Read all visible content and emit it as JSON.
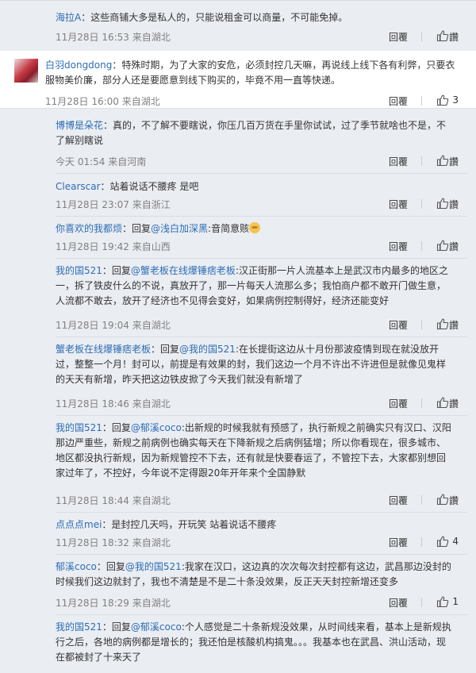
{
  "comments": [
    {
      "user": "海拉A",
      "body": "：这些商铺大多是私人的，只能说租金可以商量，不可能免掉。",
      "time": "11月28日 16:53 来自湖北",
      "reply_label": "回覆",
      "like_label": "讚"
    },
    {
      "user": "白羽dongdong",
      "body": "：特殊时期，为了大家的安危，必须封控几天嘛，再说线上线下各有利弊，只要衣服物美价廉，部分人还是要愿意到线下购买的，毕竟不用一直等快递。",
      "time": "11月28日 16:00 来自湖北",
      "reply_label": "回覆",
      "like_count": "3"
    },
    {
      "user": "博博是朵花",
      "body": "：真的，不了解不要瞎说，你压几百万货在手里你试试，过了季节就啥也不是，不了解别瞎说",
      "time": "今天 01:54 来自河南",
      "reply_label": "回覆",
      "like_label": "讚"
    },
    {
      "user": "Clearscar",
      "body": "：站着说话不腰疼 是吧",
      "time": "11月28日 23:07 来自浙江",
      "reply_label": "回覆",
      "like_label": "讚"
    },
    {
      "user": "你喜欢的我都烦",
      "reply_prefix": "：回复",
      "reply_target": "@浅白加深黑",
      "body": ":音简意赅",
      "time": "11月28日 19:42 来自山西",
      "reply_label": "回覆",
      "like_label": "讚"
    },
    {
      "user": "我的国521",
      "reply_prefix": "：回复",
      "reply_target": "@蟹老板在线爆锤痞老板",
      "body": ":汉正街那一片人流基本上是武汉市内最多的地区之一，拆了铁皮什么的不说，真放开了，那一片每天人流那么多；我怕商户都不敢开门做生意，人流都不敢去，放开了经济也不见得会变好，如果病例控制得好，经济还能变好",
      "time": "11月28日 19:04 来自湖北",
      "reply_label": "回覆",
      "like_label": "讚"
    },
    {
      "user": "蟹老板在线爆锤痞老板",
      "reply_prefix": "：回复",
      "reply_target": "@我的国521",
      "body": ":在长提街这边从十月份那波疫情到现在就没放开过，整整一个月！封可以，前提是有效果的封，我们这边一个月不许出不许进但是就像见鬼样的天天有新增，昨天把这边铁皮掀了今天我们就没有新增了",
      "time": "11月28日 18:46 来自湖北",
      "reply_label": "回覆",
      "like_label": "讚"
    },
    {
      "user": "我的国521",
      "reply_prefix": "：回复",
      "reply_target": "@郁溪coco",
      "body": ":出新规的时候我就有预感了，执行新规之前确实只有汉口、汉阳那边严重些，新规之前病例也确实每天在下降新规之后病例猛增；所以你看现在，很多城市、地区都没执行新规，因为新规管控不下去，还有就是快要春运了，不管控下去，大家都别想回家过年了，不控好，今年说不定得跟20年开年来个全国静默",
      "time": "11月28日 18:44 来自湖北",
      "reply_label": "回覆",
      "like_label": "讚"
    },
    {
      "user": "点点点mei",
      "body": "：是封控几天吗，开玩笑 站着说话不腰疼",
      "time": "11月28日 18:32 来自湖北",
      "reply_label": "回覆",
      "like_count": "4"
    },
    {
      "user": "郁溪coco",
      "reply_prefix": "：回复",
      "reply_target": "@我的国521",
      "body": ":我家在汉口，这边真的次次每次封控都有这边，武昌那边没封的时候我们这边就封了，我也不清楚是不是二十条没效果，反正天天封控新增还变多",
      "time": "11月28日 18:29 来自湖北",
      "reply_label": "回覆",
      "like_count": "1"
    },
    {
      "user": "我的国521",
      "reply_prefix": "：回复",
      "reply_target": "@郁溪coco",
      "body": ":个人感觉是二十条新规没效果，从时间线来看，基本上是新规执行之后，各地的病例都是增长的；我还怕是核酸机构搞鬼。。。我基本也在武昌、洪山活动，现在都被封了十来天了"
    }
  ],
  "colors": {
    "link": "#2d6db5",
    "meta": "#808080",
    "panel": "#eaedf2"
  },
  "icons": {
    "avatar": "avatar-image",
    "like": "thumbs-up-icon"
  }
}
